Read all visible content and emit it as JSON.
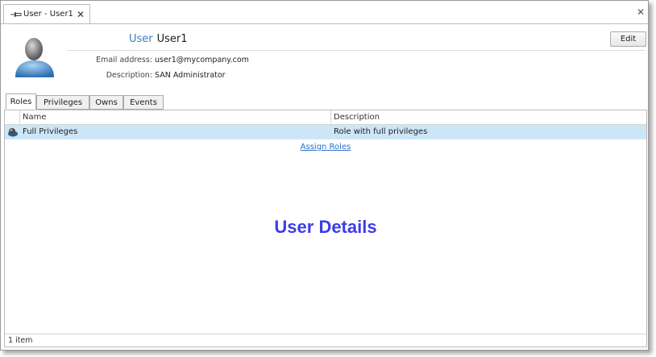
{
  "window": {
    "tab_title": "User - User1",
    "tab_close_icon": "close-icon",
    "window_close_icon": "close-icon"
  },
  "header": {
    "kind": "User",
    "name": "User1",
    "edit_label": "Edit",
    "email_label": "Email address:",
    "email_value": "user1@mycompany.com",
    "description_label": "Description:",
    "description_value": "SAN Administrator"
  },
  "tabs": [
    {
      "label": "Roles",
      "active": true
    },
    {
      "label": "Privileges",
      "active": false
    },
    {
      "label": "Owns",
      "active": false
    },
    {
      "label": "Events",
      "active": false
    }
  ],
  "grid": {
    "columns": [
      "Name",
      "Description"
    ],
    "rows": [
      {
        "name": "Full Privileges",
        "description": "Role with full privileges",
        "icon": "role-icon",
        "selected": true
      }
    ],
    "assign_link": "Assign Roles"
  },
  "overlay_title": "User Details",
  "status": {
    "text": "1 item"
  },
  "colors": {
    "accent": "#3e7cc0",
    "selection": "#cde6f7",
    "overlay": "#3c3cea",
    "link": "#2a6fc9"
  }
}
